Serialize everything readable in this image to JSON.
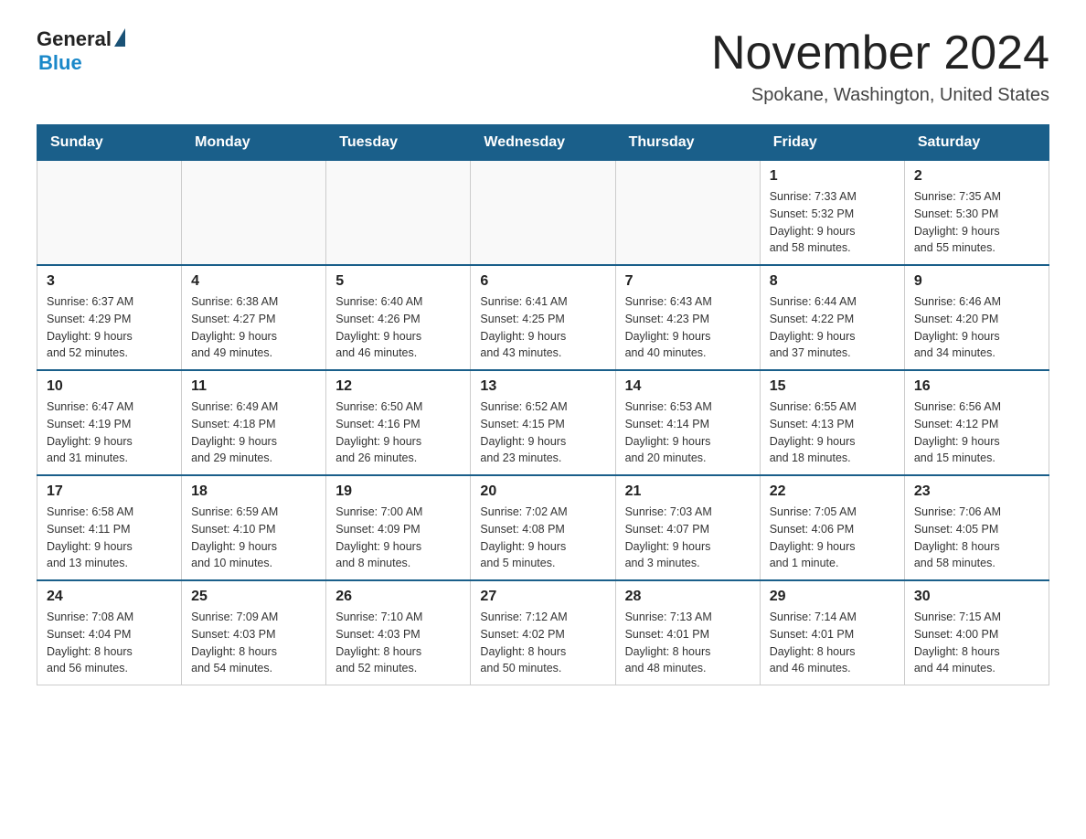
{
  "header": {
    "logo": {
      "general": "General",
      "blue": "Blue"
    },
    "title": "November 2024",
    "location": "Spokane, Washington, United States"
  },
  "calendar": {
    "days_of_week": [
      "Sunday",
      "Monday",
      "Tuesday",
      "Wednesday",
      "Thursday",
      "Friday",
      "Saturday"
    ],
    "weeks": [
      [
        {
          "day": "",
          "info": ""
        },
        {
          "day": "",
          "info": ""
        },
        {
          "day": "",
          "info": ""
        },
        {
          "day": "",
          "info": ""
        },
        {
          "day": "",
          "info": ""
        },
        {
          "day": "1",
          "info": "Sunrise: 7:33 AM\nSunset: 5:32 PM\nDaylight: 9 hours\nand 58 minutes."
        },
        {
          "day": "2",
          "info": "Sunrise: 7:35 AM\nSunset: 5:30 PM\nDaylight: 9 hours\nand 55 minutes."
        }
      ],
      [
        {
          "day": "3",
          "info": "Sunrise: 6:37 AM\nSunset: 4:29 PM\nDaylight: 9 hours\nand 52 minutes."
        },
        {
          "day": "4",
          "info": "Sunrise: 6:38 AM\nSunset: 4:27 PM\nDaylight: 9 hours\nand 49 minutes."
        },
        {
          "day": "5",
          "info": "Sunrise: 6:40 AM\nSunset: 4:26 PM\nDaylight: 9 hours\nand 46 minutes."
        },
        {
          "day": "6",
          "info": "Sunrise: 6:41 AM\nSunset: 4:25 PM\nDaylight: 9 hours\nand 43 minutes."
        },
        {
          "day": "7",
          "info": "Sunrise: 6:43 AM\nSunset: 4:23 PM\nDaylight: 9 hours\nand 40 minutes."
        },
        {
          "day": "8",
          "info": "Sunrise: 6:44 AM\nSunset: 4:22 PM\nDaylight: 9 hours\nand 37 minutes."
        },
        {
          "day": "9",
          "info": "Sunrise: 6:46 AM\nSunset: 4:20 PM\nDaylight: 9 hours\nand 34 minutes."
        }
      ],
      [
        {
          "day": "10",
          "info": "Sunrise: 6:47 AM\nSunset: 4:19 PM\nDaylight: 9 hours\nand 31 minutes."
        },
        {
          "day": "11",
          "info": "Sunrise: 6:49 AM\nSunset: 4:18 PM\nDaylight: 9 hours\nand 29 minutes."
        },
        {
          "day": "12",
          "info": "Sunrise: 6:50 AM\nSunset: 4:16 PM\nDaylight: 9 hours\nand 26 minutes."
        },
        {
          "day": "13",
          "info": "Sunrise: 6:52 AM\nSunset: 4:15 PM\nDaylight: 9 hours\nand 23 minutes."
        },
        {
          "day": "14",
          "info": "Sunrise: 6:53 AM\nSunset: 4:14 PM\nDaylight: 9 hours\nand 20 minutes."
        },
        {
          "day": "15",
          "info": "Sunrise: 6:55 AM\nSunset: 4:13 PM\nDaylight: 9 hours\nand 18 minutes."
        },
        {
          "day": "16",
          "info": "Sunrise: 6:56 AM\nSunset: 4:12 PM\nDaylight: 9 hours\nand 15 minutes."
        }
      ],
      [
        {
          "day": "17",
          "info": "Sunrise: 6:58 AM\nSunset: 4:11 PM\nDaylight: 9 hours\nand 13 minutes."
        },
        {
          "day": "18",
          "info": "Sunrise: 6:59 AM\nSunset: 4:10 PM\nDaylight: 9 hours\nand 10 minutes."
        },
        {
          "day": "19",
          "info": "Sunrise: 7:00 AM\nSunset: 4:09 PM\nDaylight: 9 hours\nand 8 minutes."
        },
        {
          "day": "20",
          "info": "Sunrise: 7:02 AM\nSunset: 4:08 PM\nDaylight: 9 hours\nand 5 minutes."
        },
        {
          "day": "21",
          "info": "Sunrise: 7:03 AM\nSunset: 4:07 PM\nDaylight: 9 hours\nand 3 minutes."
        },
        {
          "day": "22",
          "info": "Sunrise: 7:05 AM\nSunset: 4:06 PM\nDaylight: 9 hours\nand 1 minute."
        },
        {
          "day": "23",
          "info": "Sunrise: 7:06 AM\nSunset: 4:05 PM\nDaylight: 8 hours\nand 58 minutes."
        }
      ],
      [
        {
          "day": "24",
          "info": "Sunrise: 7:08 AM\nSunset: 4:04 PM\nDaylight: 8 hours\nand 56 minutes."
        },
        {
          "day": "25",
          "info": "Sunrise: 7:09 AM\nSunset: 4:03 PM\nDaylight: 8 hours\nand 54 minutes."
        },
        {
          "day": "26",
          "info": "Sunrise: 7:10 AM\nSunset: 4:03 PM\nDaylight: 8 hours\nand 52 minutes."
        },
        {
          "day": "27",
          "info": "Sunrise: 7:12 AM\nSunset: 4:02 PM\nDaylight: 8 hours\nand 50 minutes."
        },
        {
          "day": "28",
          "info": "Sunrise: 7:13 AM\nSunset: 4:01 PM\nDaylight: 8 hours\nand 48 minutes."
        },
        {
          "day": "29",
          "info": "Sunrise: 7:14 AM\nSunset: 4:01 PM\nDaylight: 8 hours\nand 46 minutes."
        },
        {
          "day": "30",
          "info": "Sunrise: 7:15 AM\nSunset: 4:00 PM\nDaylight: 8 hours\nand 44 minutes."
        }
      ]
    ]
  }
}
